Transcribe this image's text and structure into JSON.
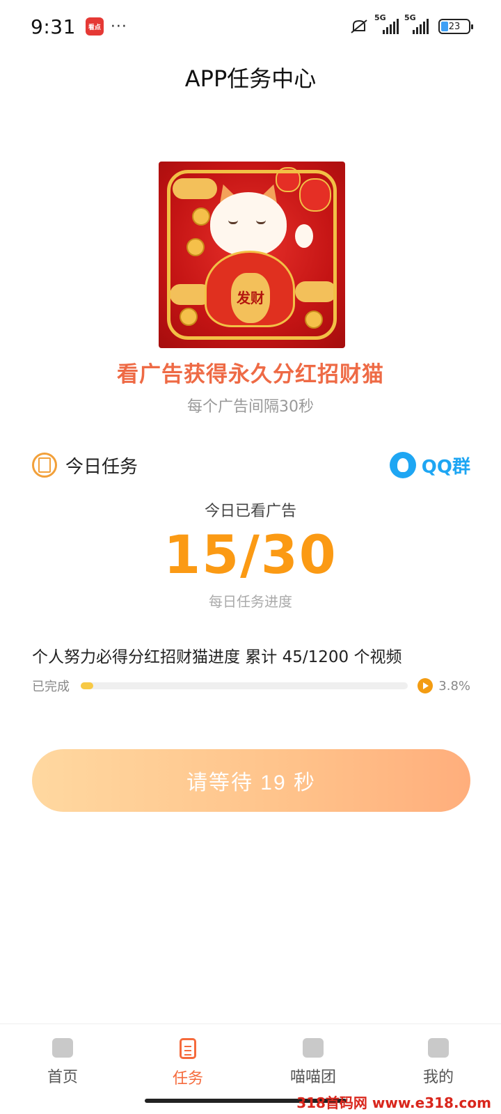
{
  "status_bar": {
    "time": "9:31",
    "app_badge": "看点",
    "more": "···",
    "signal1_label": "5G",
    "signal2_label": "5G",
    "battery": "23"
  },
  "header": {
    "title": "APP任务中心"
  },
  "hero": {
    "image_text": "发财",
    "headline": "看广告获得永久分红招财猫",
    "subtitle": "每个广告间隔30秒"
  },
  "task": {
    "title": "今日任务",
    "qq_label": "QQ群",
    "watched_label": "今日已看广告",
    "watched_count": "15/30",
    "watched_sub": "每日任务进度"
  },
  "progress": {
    "text": "个人努力必得分红招财猫进度 累计 45/1200 个视频",
    "done_label": "已完成",
    "percent_label": "3.8%",
    "fraction": 0.038
  },
  "action": {
    "button_label": "请等待 19 秒"
  },
  "nav": {
    "items": [
      {
        "label": "首页",
        "icon": "castle-icon"
      },
      {
        "label": "任务",
        "icon": "clipboard-icon"
      },
      {
        "label": "喵喵团",
        "icon": "paw-icon"
      },
      {
        "label": "我的",
        "icon": "cat-face-icon"
      }
    ],
    "active_index": 1
  },
  "watermark": "318首码网 www.e318.com",
  "colors": {
    "accent": "#fb9a14",
    "headline": "#ee6a45",
    "qq": "#1ea6f3",
    "nav_active": "#f56a3c"
  }
}
